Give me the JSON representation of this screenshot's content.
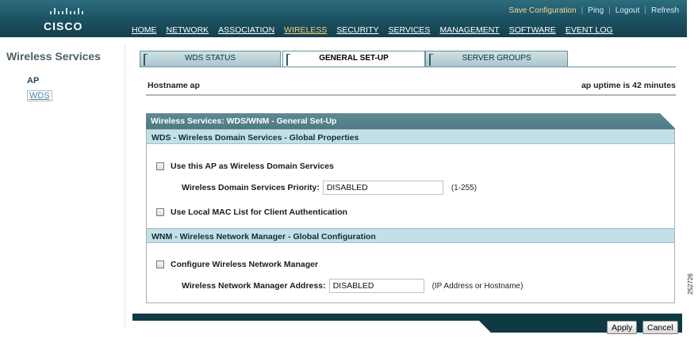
{
  "brand": {
    "logo_text": "CISCO",
    "colors": {
      "header": "#1d5565",
      "section": "#c4e0e6",
      "panel_head": "#5e8a94",
      "nav_active": "#f5d28c"
    }
  },
  "top_links": [
    "Save Configuration",
    "Ping",
    "Logout",
    "Refresh"
  ],
  "nav": [
    "HOME",
    "NETWORK",
    "ASSOCIATION",
    "WIRELESS",
    "SECURITY",
    "SERVICES",
    "MANAGEMENT",
    "SOFTWARE",
    "EVENT LOG"
  ],
  "nav_active": "WIRELESS",
  "sidebar": {
    "title": "Wireless Services",
    "items": [
      "AP",
      "WDS"
    ]
  },
  "tabs": [
    "WDS STATUS",
    "GENERAL SET-UP",
    "SERVER GROUPS"
  ],
  "tab_active": "GENERAL SET-UP",
  "hostname": "Hostname ap",
  "uptime": "ap uptime is 42 minutes",
  "panel": {
    "title": "Wireless Services: WDS/WNM - General Set-Up",
    "wds_section": "WDS - Wireless Domain Services - Global Properties",
    "wds_checkbox": "Use this AP as Wireless Domain Services",
    "wds_checked": false,
    "priority_label": "Wireless Domain Services Priority:",
    "priority_value": "DISABLED",
    "priority_hint": "(1-255)",
    "mac_checkbox": "Use Local MAC List for Client Authentication",
    "mac_checked": false,
    "wnm_section": "WNM - Wireless Network Manager - Global Configuration",
    "wnm_checkbox": "Configure Wireless Network Manager",
    "wnm_checked": false,
    "wnm_address_label": "Wireless Network Manager Address:",
    "wnm_address_value": "DISABLED",
    "wnm_address_hint": "(IP Address or Hostname)"
  },
  "buttons": {
    "apply": "Apply",
    "cancel": "Cancel"
  },
  "figure_code": "252726"
}
